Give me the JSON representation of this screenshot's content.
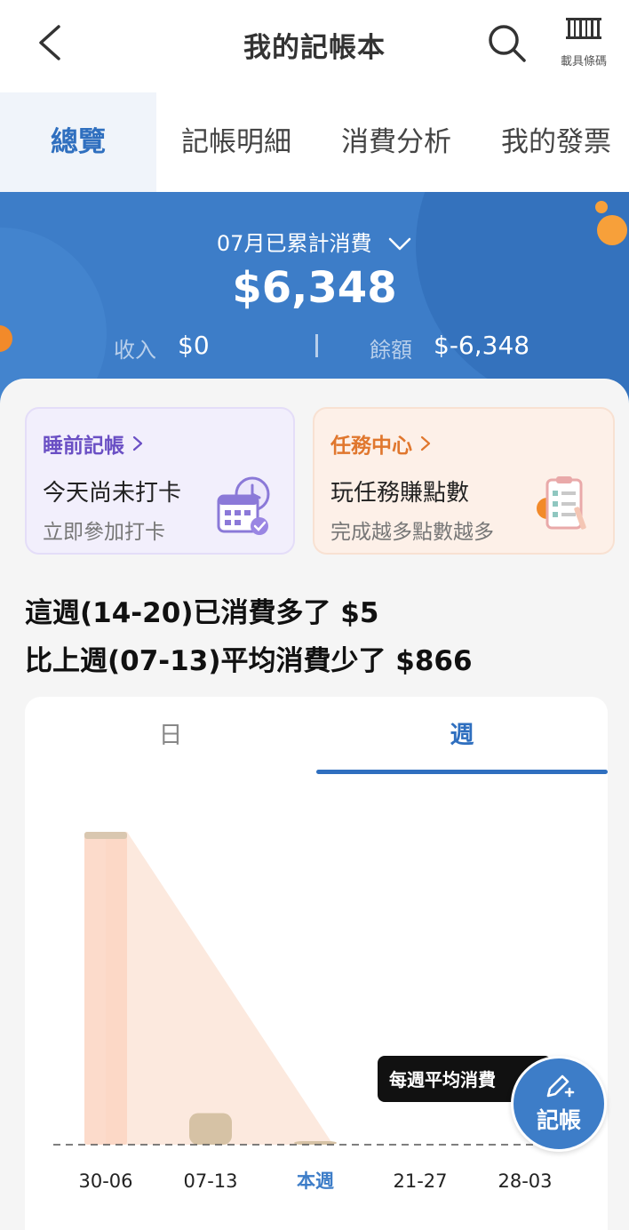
{
  "header": {
    "title": "我的記帳本",
    "carrier_label": "載具條碼"
  },
  "tabs": [
    {
      "label": "總覽",
      "active": true
    },
    {
      "label": "記帳明細",
      "active": false
    },
    {
      "label": "消費分析",
      "active": false
    },
    {
      "label": "我的發票",
      "active": false
    }
  ],
  "summary": {
    "month_label": "07月已累計消費",
    "total": "$6,348",
    "income_label": "收入",
    "income_value": "$0",
    "balance_label": "餘額",
    "balance_value": "$-6,348"
  },
  "cards": [
    {
      "title": "睡前記帳",
      "main": "今天尚未打卡",
      "sub": "立即參加打卡",
      "icon": "calendar-clock-icon"
    },
    {
      "title": "任務中心",
      "main": "玩任務賺點數",
      "sub": "完成越多點數越多",
      "icon": "checklist-icon"
    }
  ],
  "week_message": {
    "line1": "這週(14-20)已消費多了 $5",
    "line2": "比上週(07-13)平均消費少了 $866"
  },
  "chart_tabs": {
    "day": "日",
    "week": "週",
    "active": "week"
  },
  "chart_data": {
    "type": "bar",
    "categories": [
      "30-06",
      "07-13",
      "本週",
      "21-27",
      "28-03"
    ],
    "values": [
      5460,
      550,
      5,
      0,
      0
    ],
    "highlight_category": "本週",
    "reference_line_label": "每週平均消費"
  },
  "fab": {
    "label": "記帳"
  },
  "colors": {
    "primary": "#3d7dc8",
    "accent_orange": "#f7a03a",
    "bar_past": "#fbd5c2",
    "bar_prev": "#d6c2a5",
    "bar_cap": "#d9c7b0"
  }
}
